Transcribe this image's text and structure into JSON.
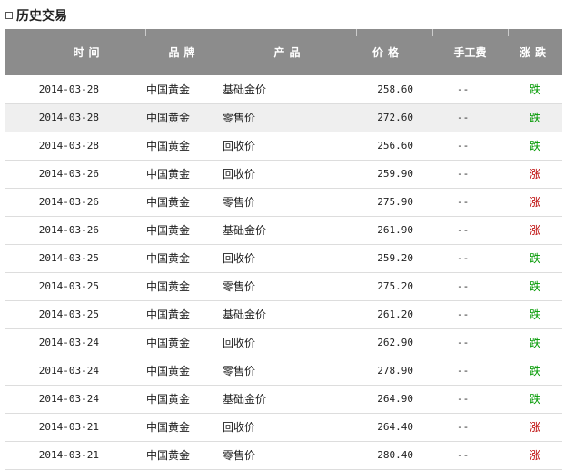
{
  "section": {
    "title": "历史交易"
  },
  "table": {
    "headers": {
      "time": "时间",
      "brand": "品牌",
      "product": "产品",
      "price": "价格",
      "fee": "手工费",
      "change": "涨跌"
    },
    "rows": [
      {
        "date": "2014-03-28",
        "brand": "中国黄金",
        "product": "基础金价",
        "price": "258.60",
        "fee": "--",
        "change": "跌"
      },
      {
        "date": "2014-03-28",
        "brand": "中国黄金",
        "product": "零售价",
        "price": "272.60",
        "fee": "--",
        "change": "跌"
      },
      {
        "date": "2014-03-28",
        "brand": "中国黄金",
        "product": "回收价",
        "price": "256.60",
        "fee": "--",
        "change": "跌"
      },
      {
        "date": "2014-03-26",
        "brand": "中国黄金",
        "product": "回收价",
        "price": "259.90",
        "fee": "--",
        "change": "涨"
      },
      {
        "date": "2014-03-26",
        "brand": "中国黄金",
        "product": "零售价",
        "price": "275.90",
        "fee": "--",
        "change": "涨"
      },
      {
        "date": "2014-03-26",
        "brand": "中国黄金",
        "product": "基础金价",
        "price": "261.90",
        "fee": "--",
        "change": "涨"
      },
      {
        "date": "2014-03-25",
        "brand": "中国黄金",
        "product": "回收价",
        "price": "259.20",
        "fee": "--",
        "change": "跌"
      },
      {
        "date": "2014-03-25",
        "brand": "中国黄金",
        "product": "零售价",
        "price": "275.20",
        "fee": "--",
        "change": "跌"
      },
      {
        "date": "2014-03-25",
        "brand": "中国黄金",
        "product": "基础金价",
        "price": "261.20",
        "fee": "--",
        "change": "跌"
      },
      {
        "date": "2014-03-24",
        "brand": "中国黄金",
        "product": "回收价",
        "price": "262.90",
        "fee": "--",
        "change": "跌"
      },
      {
        "date": "2014-03-24",
        "brand": "中国黄金",
        "product": "零售价",
        "price": "278.90",
        "fee": "--",
        "change": "跌"
      },
      {
        "date": "2014-03-24",
        "brand": "中国黄金",
        "product": "基础金价",
        "price": "264.90",
        "fee": "--",
        "change": "跌"
      },
      {
        "date": "2014-03-21",
        "brand": "中国黄金",
        "product": "回收价",
        "price": "264.40",
        "fee": "--",
        "change": "涨"
      },
      {
        "date": "2014-03-21",
        "brand": "中国黄金",
        "product": "零售价",
        "price": "280.40",
        "fee": "--",
        "change": "涨"
      }
    ]
  },
  "colors": {
    "header_bg": "#8c8c8c",
    "alt_row_bg": "#efefef",
    "up": "#bb0000",
    "down": "#009900"
  }
}
